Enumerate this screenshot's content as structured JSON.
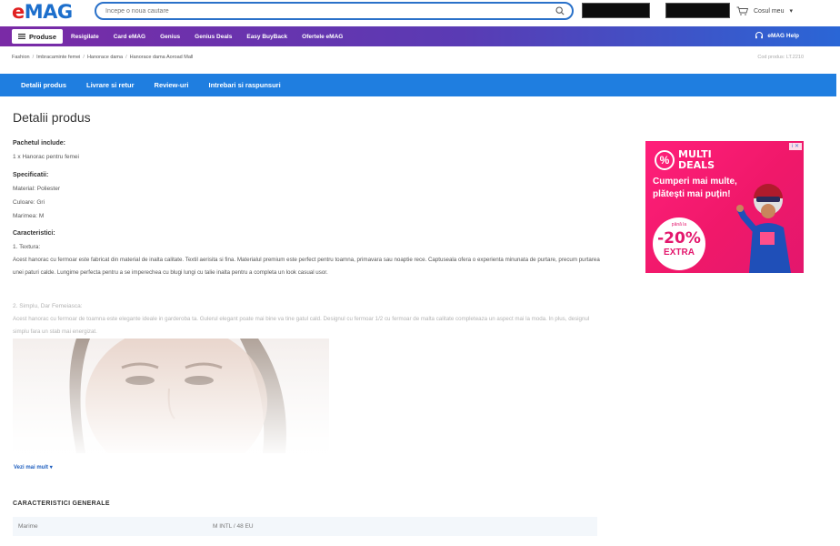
{
  "header": {
    "logo_text": "eMAG",
    "search_placeholder": "Incepe o noua cautare",
    "cart_label": "Cosul meu"
  },
  "nav": {
    "produse_label": "Produse",
    "links": [
      "Resigilate",
      "Card eMAG",
      "Genius",
      "Genius Deals",
      "Easy BuyBack",
      "Ofertele eMAG"
    ],
    "help_label": "eMAG Help"
  },
  "breadcrumb": {
    "items": [
      "Fashion",
      "Imbracaminte femei",
      "Hanorace dama",
      "Hanorace dama Aoroad Mall"
    ],
    "cod_produs": "Cod produs: LT.2210"
  },
  "tabs": [
    "Detalii produs",
    "Livrare si retur",
    "Review-uri",
    "Intrebari si raspunsuri"
  ],
  "details": {
    "title": "Detalii produs",
    "pachet_label": "Pachetul include:",
    "pachet_value": "1 x Hanorac pentru femei",
    "spec_label": "Specificatii:",
    "spec_material": "Material: Poliester",
    "spec_culoare": "Culoare: Gri",
    "spec_marime": "Marimea: M",
    "caract_label": "Caracteristici:",
    "caract_1": "1. Textura:",
    "caract_1_text": "Acest hanorac cu fermoar este fabricat din material de inalta calitate. Textil aerisita si fina. Materialul premium este perfect pentru toamna, primavara sau noaptie rece. Captuseala ofera o experienta minunata de purtare, precum purtarea unei paturi calde. Lungime perfecta pentru a se imperechea cu blugi lungi cu talie inalta pentru a completa un look casual usor.",
    "caract_2": "2. Simplu, Dar Femeiasca:",
    "caract_2_text": "Acest hanorac cu fermoar de toamna este elegante ideale in garderoba ta. Gulerul elegant poate mai bine va tine gatul cald. Designul cu fermoar 1/2 cu fermoar de malta calitate completeaza un aspect mai la moda. In plus, designul simplu fara un stab mai energizat.",
    "see_more": "Vezi mai mult"
  },
  "general": {
    "title": "CARACTERISTICI GENERALE",
    "row_key": "Marime",
    "row_value": "M INTL / 48 EU"
  },
  "ad": {
    "multi_line1": "MULTI",
    "multi_line2": "DEALS",
    "tagline": "Cumperi mai multe, plătești mai puțin!",
    "bubble_small": "până la",
    "bubble_big": "-20%",
    "bubble_extra": "EXTRA",
    "close_mark": "i ✕",
    "brand_color": "#e3176d"
  }
}
